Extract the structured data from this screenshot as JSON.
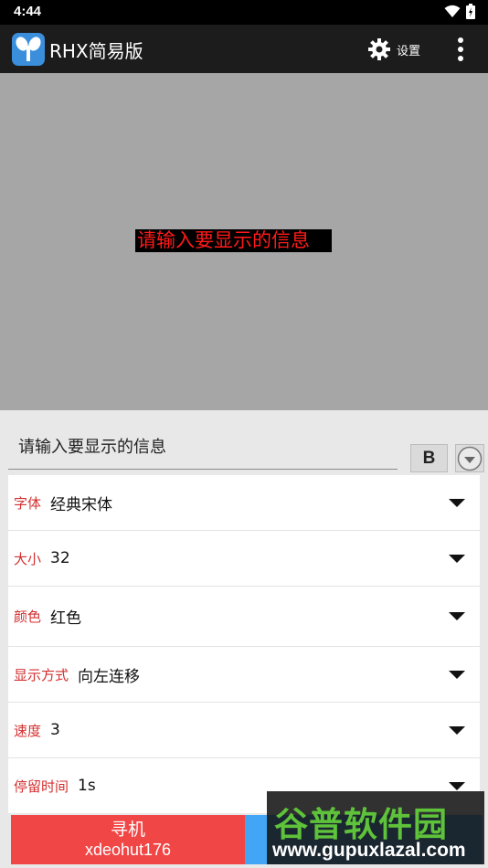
{
  "status_bar": {
    "time": "4:44"
  },
  "app_bar": {
    "title": "RHX简易版",
    "settings_label": "设置"
  },
  "preview": {
    "text": "请输入要显示的信息",
    "text_color": "#ff1a1a",
    "background": "#000000"
  },
  "input": {
    "value": "请输入要显示的信息"
  },
  "bold_button": {
    "label": "B"
  },
  "settings": {
    "font": {
      "label": "字体",
      "value": "经典宋体"
    },
    "size": {
      "label": "大小",
      "value": "32"
    },
    "color": {
      "label": "颜色",
      "value": "红色"
    },
    "mode": {
      "label": "显示方式",
      "value": "向左连移"
    },
    "speed": {
      "label": "速度",
      "value": "3"
    },
    "pause": {
      "label": "停留时间",
      "value": "1s"
    }
  },
  "bottom": {
    "find_label": "寻机",
    "find_sub": "xdeohut176"
  },
  "watermark": {
    "title": "谷普软件园",
    "url": "www.gupuxlazal.com"
  },
  "colors": {
    "accent_red": "#d32f2f",
    "find_button": "#f04646",
    "blue_button": "#42a5f5",
    "app_bar": "#1c1c1c"
  }
}
